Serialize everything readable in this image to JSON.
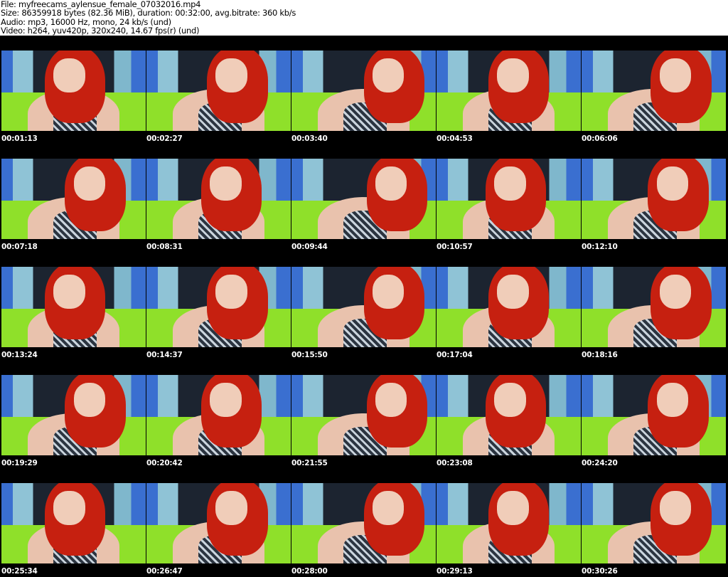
{
  "header": {
    "file": "File: myfreecams_aylensue_female_07032016.mp4",
    "size": "Size: 86359918 bytes (82.36 MiB), duration: 00:32:00, avg.bitrate: 360 kb/s",
    "audio": "Audio: mp3, 16000 Hz, mono, 24 kb/s (und)",
    "video": "Video: h264, yuv420p, 320x240, 14.67 fps(r) (und)"
  },
  "thumbnails": [
    {
      "timestamp": "00:01:13"
    },
    {
      "timestamp": "00:02:27"
    },
    {
      "timestamp": "00:03:40"
    },
    {
      "timestamp": "00:04:53"
    },
    {
      "timestamp": "00:06:06"
    },
    {
      "timestamp": "00:07:18"
    },
    {
      "timestamp": "00:08:31"
    },
    {
      "timestamp": "00:09:44"
    },
    {
      "timestamp": "00:10:57"
    },
    {
      "timestamp": "00:12:10"
    },
    {
      "timestamp": "00:13:24"
    },
    {
      "timestamp": "00:14:37"
    },
    {
      "timestamp": "00:15:50"
    },
    {
      "timestamp": "00:17:04"
    },
    {
      "timestamp": "00:18:16"
    },
    {
      "timestamp": "00:19:29"
    },
    {
      "timestamp": "00:20:42"
    },
    {
      "timestamp": "00:21:55"
    },
    {
      "timestamp": "00:23:08"
    },
    {
      "timestamp": "00:24:20"
    },
    {
      "timestamp": "00:25:34"
    },
    {
      "timestamp": "00:26:47"
    },
    {
      "timestamp": "00:28:00"
    },
    {
      "timestamp": "00:29:13"
    },
    {
      "timestamp": "00:30:26"
    }
  ]
}
